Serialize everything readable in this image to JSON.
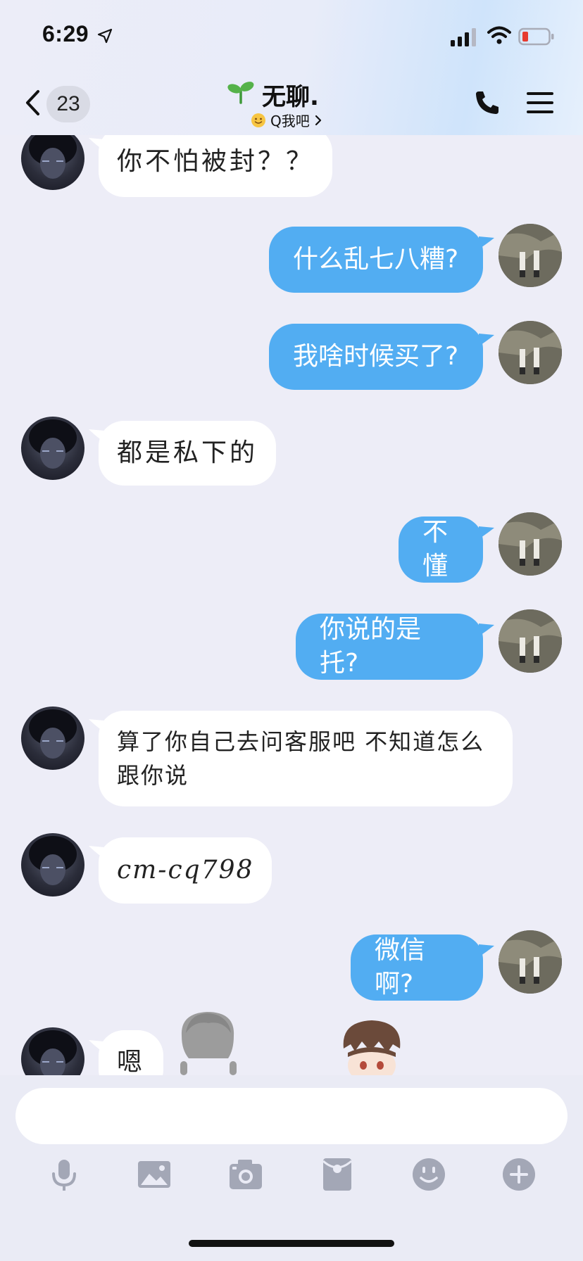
{
  "status_bar": {
    "time": "6:29"
  },
  "header": {
    "unread_count": "23",
    "title": "无聊.",
    "subtitle": "Q我吧"
  },
  "messages": [
    {
      "side": "in",
      "text": "你不怕被封？？"
    },
    {
      "side": "out",
      "text": "什么乱七八糟?"
    },
    {
      "side": "out",
      "text": "我啥时候买了?"
    },
    {
      "side": "in",
      "text": "都是私下的"
    },
    {
      "side": "out",
      "text": "不懂"
    },
    {
      "side": "out",
      "text": "你说的是托?"
    },
    {
      "side": "in",
      "text": "算了你自己去问客服吧 不知道怎么跟你说"
    },
    {
      "side": "in",
      "text": "cm-cq798"
    },
    {
      "side": "out",
      "text": "微信啊?"
    },
    {
      "side": "in",
      "text": "嗯"
    }
  ],
  "input": {
    "value": "",
    "placeholder": ""
  },
  "toolbar": {
    "icons": [
      "microphone-icon",
      "image-icon",
      "camera-icon",
      "red-packet-icon",
      "emoji-icon",
      "plus-icon"
    ]
  },
  "colors": {
    "outgoing_bubble": "#52adf2",
    "incoming_bubble": "#ffffff",
    "background": "#ededf7"
  }
}
